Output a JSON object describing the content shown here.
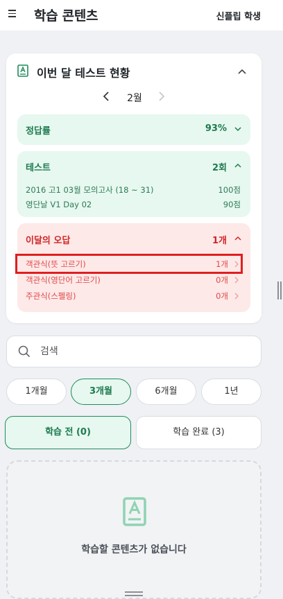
{
  "header": {
    "title": "학습 콘텐츠",
    "user": "신플립 학생"
  },
  "status_card": {
    "title": "이번 달 테스트 현황",
    "month": "2월",
    "accuracy": {
      "label": "정답률",
      "value": "93%"
    },
    "tests": {
      "label": "테스트",
      "value": "2회",
      "items": [
        {
          "name": "2016 고1 03월 모의고사 (18 ~ 31)",
          "score": "100점"
        },
        {
          "name": "영단날 V1 Day 02",
          "score": "90점"
        }
      ]
    },
    "wrong": {
      "label": "이달의 오답",
      "value": "1개",
      "items": [
        {
          "name": "객관식(뜻 고르기)",
          "count": "1개"
        },
        {
          "name": "객관식(영단어 고르기)",
          "count": "0개"
        },
        {
          "name": "주관식(스펠링)",
          "count": "0개"
        }
      ]
    }
  },
  "search": {
    "placeholder": "검색"
  },
  "periods": [
    "1개월",
    "3개월",
    "6개월",
    "1년"
  ],
  "selected_period": "3개월",
  "status_tabs": {
    "before": "학습 전 (0)",
    "done": "학습 완료 (3)"
  },
  "empty": {
    "message": "학습할 콘텐츠가 없습니다"
  },
  "colors": {
    "accent_green": "#1f8b5c",
    "green_bg": "#e6f8ef",
    "red": "#d02525",
    "red_bg": "#fde9e8",
    "highlight": "#e01e1e"
  }
}
